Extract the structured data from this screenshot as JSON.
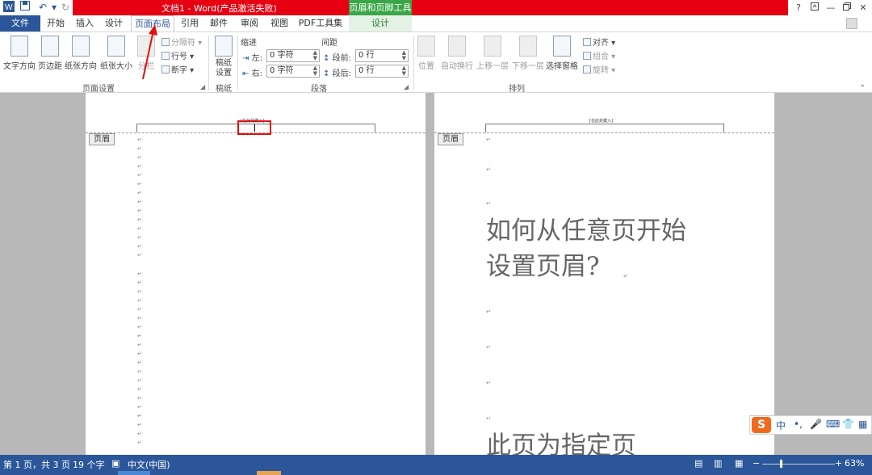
{
  "titlebar": {
    "title": "文档1 - Word(产品激活失败)",
    "context_tab": "页眉和页脚工具",
    "help": "?",
    "minimize": "—",
    "close": "✕"
  },
  "tabs": [
    "文件",
    "开始",
    "插入",
    "设计",
    "页面布局",
    "引用",
    "邮件",
    "审阅",
    "视图",
    "PDF工具集",
    "设计"
  ],
  "ribbon": {
    "page_setup": {
      "text_direction": "文字方向",
      "margins": "页边距",
      "orientation": "纸张方向",
      "size": "纸张大小",
      "columns": "分栏",
      "breaks": "分隔符",
      "line_numbers": "行号",
      "hyphenation": "断字",
      "label": "页面设置"
    },
    "draft": {
      "button": "稿纸设置",
      "label": "稿纸"
    },
    "paragraph": {
      "indent": "缩进",
      "spacing": "间距",
      "left_label": "左:",
      "left_value": "0 字符",
      "right_label": "右:",
      "right_value": "0 字符",
      "before_label": "段前:",
      "before_value": "0 行",
      "after_label": "段后:",
      "after_value": "0 行",
      "label": "段落"
    },
    "arrange": {
      "position": "位置",
      "wrap": "自动换行",
      "forward": "上移一层",
      "backward": "下移一层",
      "selection_pane": "选择窗格",
      "align": "对齐",
      "group": "组合",
      "rotate": "旋转",
      "label": "排列"
    }
  },
  "document": {
    "header_placeholder": "[在此处键入]",
    "header_tag": "页眉",
    "heading_line1": "如何从任意页开始",
    "heading_line2": "设置页眉?",
    "heading_line3": "此页为指定页",
    "para_mark": "↵"
  },
  "statusbar": {
    "page": "第 1 页，共 3 页",
    "words": "19 个字",
    "language": "中文(中国)",
    "zoom": "63%"
  },
  "ime": {
    "logo": "S",
    "mode": "中",
    "punct": "•,"
  },
  "colors": {
    "title_red": "#e60012",
    "context_green": "#3aa648",
    "word_blue": "#2b579a",
    "annotation_red": "#e01010"
  }
}
